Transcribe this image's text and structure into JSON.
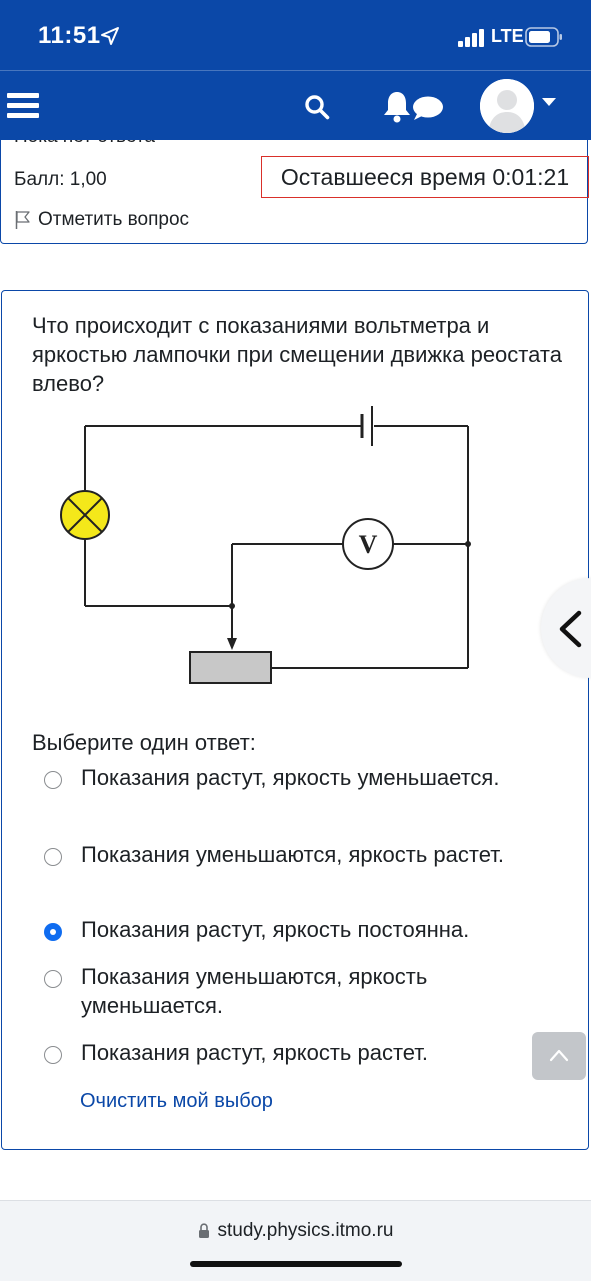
{
  "status_bar": {
    "time": "11:51",
    "network": "LTE"
  },
  "navbar": {
    "icons": [
      "menu-icon",
      "search-icon",
      "bell-icon",
      "chat-icon",
      "avatar",
      "chevron-down-icon"
    ]
  },
  "question_info": {
    "state": "Пока нет ответа",
    "grade": "Балл: 1,00",
    "flag_label": "Отметить вопрос",
    "timer": "Оставшееся время 0:01:21"
  },
  "question": {
    "text": "Что происходит с показаниями вольтметра и яркостью лампочки при смещении движка реостата влево?",
    "diagram": {
      "voltmeter_label": "V"
    },
    "prompt": "Выберите один ответ:",
    "options": [
      {
        "label": "Показания растут, яркость уменьшается.",
        "selected": false
      },
      {
        "label": "Показания уменьшаются, яркость растет.",
        "selected": false
      },
      {
        "label": "Показания растут, яркость постоянна.",
        "selected": true
      },
      {
        "label": "Показания уменьшаются, яркость уменьшается.",
        "selected": false
      },
      {
        "label": "Показания растут, яркость растет.",
        "selected": false
      }
    ],
    "clear_label": "Очистить мой выбор"
  },
  "browser": {
    "url": "study.physics.itmo.ru"
  },
  "colors": {
    "brand": "#0b48a8",
    "timer_border": "#d9302a",
    "radio_selected": "#0f6cf0",
    "lamp": "#f4e81a"
  }
}
